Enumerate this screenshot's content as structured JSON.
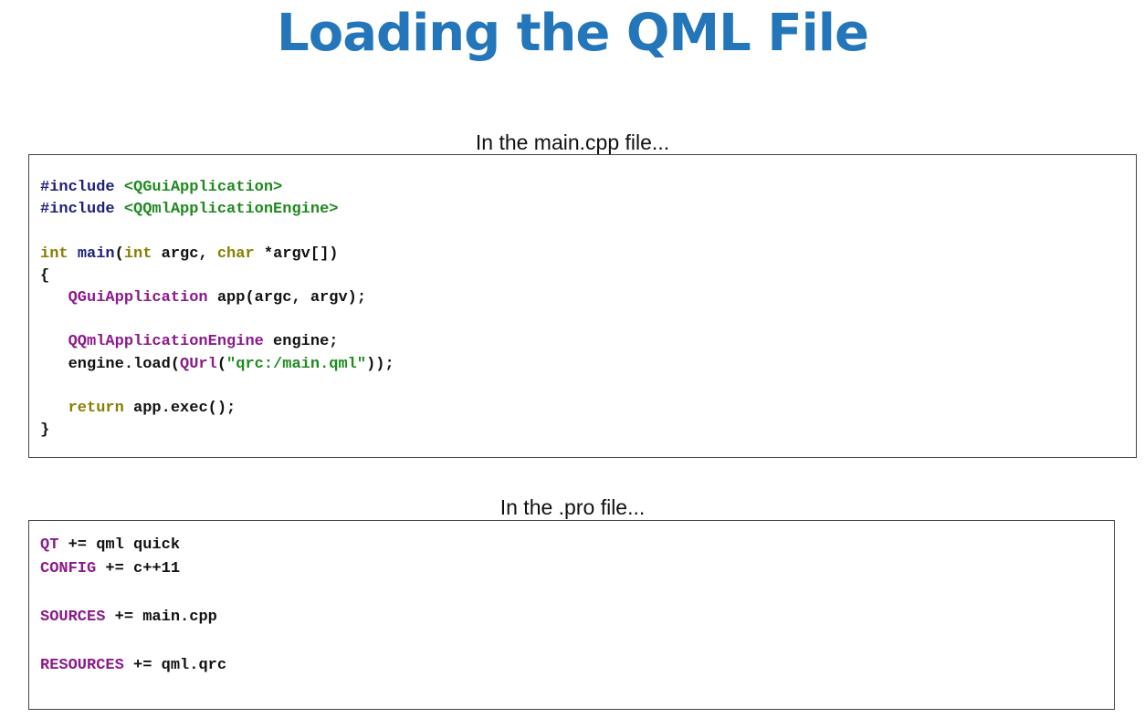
{
  "title": "Loading the QML File",
  "sections": {
    "cpp": {
      "caption": "In the main.cpp file...",
      "lines": {
        "l1_directive": "#include",
        "l1_header": "<QGuiApplication>",
        "l2_directive": "#include",
        "l2_header": "<QQmlApplicationEngine>",
        "l3_type1": "int",
        "l3_fn": "main",
        "l3_paren_open": "(",
        "l3_type2": "int",
        "l3_arg1": " argc, ",
        "l3_type3": "char",
        "l3_arg2": " *argv[])",
        "l4": "{",
        "l5_class": "QGuiApplication",
        "l5_rest": " app(argc, argv);",
        "l6_class": "QQmlApplicationEngine",
        "l6_rest": " engine;",
        "l7_pre": "engine.load(",
        "l7_class": "QUrl",
        "l7_open": "(",
        "l7_str": "\"qrc:/main.qml\"",
        "l7_close": "));",
        "l8_kw": "return",
        "l8_rest": " app.exec();",
        "l9": "}"
      }
    },
    "pro": {
      "caption": "In the .pro file...",
      "lines": {
        "p1_var": "QT",
        "p1_rest": " += qml quick",
        "p2_var": "CONFIG",
        "p2_rest": " += c++11",
        "p3_var": "SOURCES",
        "p3_rest": " += main.cpp",
        "p4_var": "RESOURCES",
        "p4_rest": " += qml.qrc"
      }
    }
  },
  "colors": {
    "title": "#2476ba",
    "include": "#1f1f7a",
    "header_path": "#1f8a1f",
    "builtin_type": "#8a7d00",
    "qt_class": "#8b1a8b",
    "string": "#1f8a1f"
  }
}
